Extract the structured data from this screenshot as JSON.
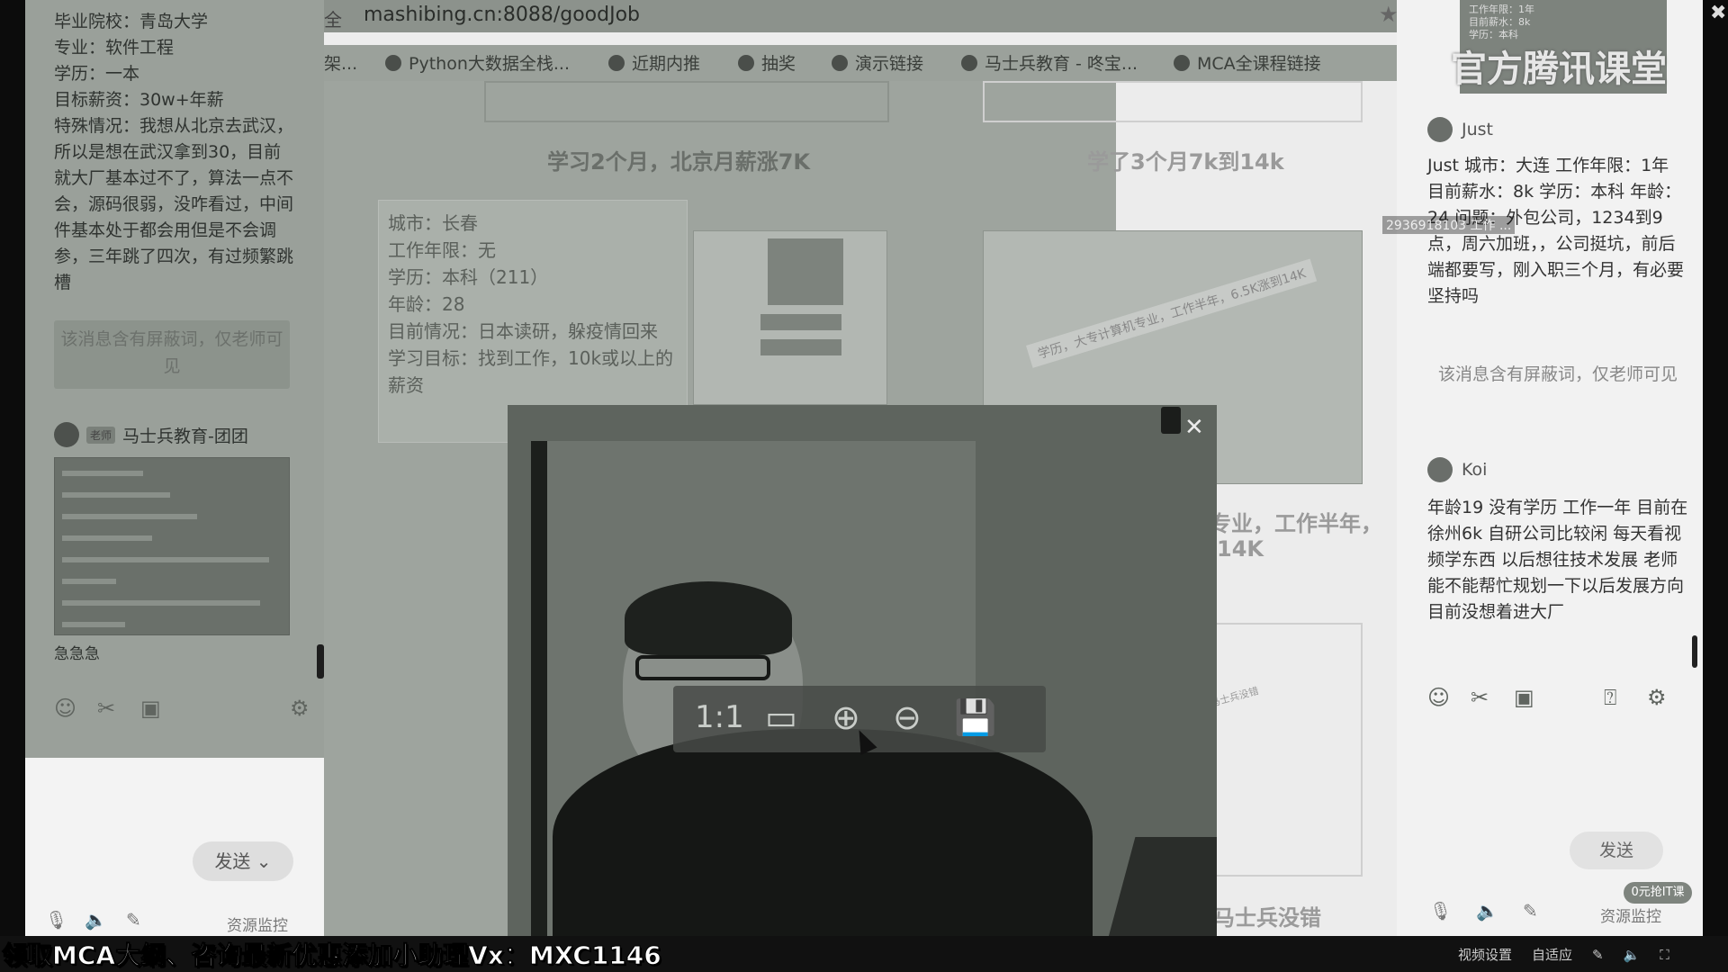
{
  "left_chat": {
    "profile_lines": [
      "毕业院校：青岛大学",
      "专业：软件工程",
      "学历：一本",
      "目标薪资：30w+年薪",
      "特殊情况：我想从北京去武汉，所以是想在武汉拿到30，目前就大厂基本过不了，算法一点不会，源码很弱，没咋看过，中间件基本处于都会用但是不会调参，三年跳了四次，有过频繁跳槽"
    ],
    "blocked_notice": "该消息含有屏蔽词，仅老师可见",
    "sender_role": "老师",
    "sender_name": "马士兵教育-团团",
    "after_image_text": "急急急",
    "send_label": "发送",
    "resource_label": "资源监控"
  },
  "browser": {
    "url_prefix": "全",
    "url": "mashibing.cn:8088/goodJob",
    "bookmarks": [
      "架...",
      "Python大数据全栈...",
      "近期内推",
      "抽奖",
      "演示链接",
      "马士兵教育 - 咚宝...",
      "MCA全课程链接"
    ],
    "headlines": {
      "left": "学习2个月，北京月薪涨7K",
      "right": "学了3个月7k到14k",
      "mid_partial": "专业，工作半年，",
      "mid_partial2": "14K",
      "bottom_right": "马士兵没错"
    },
    "info_box_lines": [
      "城市：长春",
      "工作年限：无",
      "学历：本科（211）",
      "年龄：28",
      "目前情况：日本读研，躲疫情回来",
      "学习目标：找到工作，10k或以上的薪资"
    ],
    "tilted_banner": "学历，大专计算机专业，工作半年，6.5K涨到14K",
    "small_tag": "马士兵没错",
    "zoom_controls": {
      "ratio_label": "1:1"
    }
  },
  "right_chat": {
    "watermark": "官方腾讯课堂",
    "top_thumb_lines": [
      "工作年限：1年",
      "目前薪水：8k",
      "学历：本科"
    ],
    "overlay_id": "2936918103 工作 ...",
    "messages": [
      {
        "name": "Just",
        "text": "Just 城市：大连 工作年限：1年 目前薪水：8k 学历：本科 年龄：24 问题：外包公司，1234到9点，周六加班，，公司挺坑，前后端都要写，刚入职三个月，有必要坚持吗"
      },
      {
        "name": "",
        "text": "该消息含有屏蔽词，仅老师可见"
      },
      {
        "name": "Koi",
        "text": "年龄19 没有学历 工作一年 目前在徐州6k 自研公司比较闲 每天看视频学东西 以后想往技术发展 老师能不能帮忙规划一下以后发展方向 目前没想着进大厂"
      }
    ],
    "send_label": "发送",
    "promo_label": "0元抢IT课",
    "resource_label": "资源监控"
  },
  "subtitle": "领取MCA大纲、咨询最新优惠添加小助理Vx：MXC1146",
  "status_bar": {
    "video_settings": "视频设置",
    "adaptive": "自适应"
  }
}
